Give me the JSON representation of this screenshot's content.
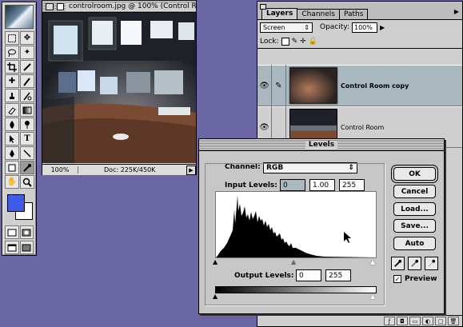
{
  "document_window": {
    "title": "controlroom.jpg @ 100% (Control Room...",
    "zoom": "100%",
    "doc_info": "Doc: 225K/450K"
  },
  "layers_palette": {
    "tabs": [
      "Layers",
      "Channels",
      "Paths"
    ],
    "blend_mode": "Screen",
    "opacity_label": "Opacity:",
    "opacity_value": "100%",
    "lock_label": "Lock:",
    "layers": [
      {
        "name": "Control Room copy",
        "active": true
      },
      {
        "name": "Control Room",
        "active": false
      }
    ]
  },
  "levels_dialog": {
    "title": "Levels",
    "channel_label": "Channel:",
    "channel_value": "RGB",
    "input_levels_label": "Input Levels:",
    "input_black": "0",
    "input_gamma": "1.00",
    "input_white": "255",
    "output_levels_label": "Output Levels:",
    "output_black": "0",
    "output_white": "255",
    "buttons": {
      "ok": "OK",
      "cancel": "Cancel",
      "load": "Load...",
      "save": "Save...",
      "auto": "Auto"
    },
    "preview_label": "Preview",
    "preview_checked": true
  },
  "colors": {
    "foreground": "#3f5be8",
    "background": "#ffffff",
    "desktop": "#6a66a3"
  }
}
